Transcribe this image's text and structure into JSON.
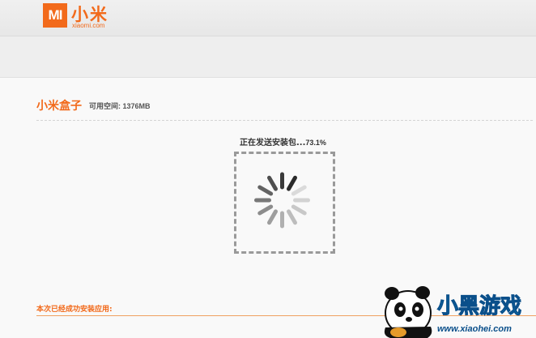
{
  "header": {
    "logo_mark": "MI",
    "logo_text": "小米",
    "logo_domain": "xiaomi.com",
    "brand_color": "#f26a1b"
  },
  "device": {
    "name": "小米盒子",
    "space_label": "可用空间:",
    "space_value": "1376MB"
  },
  "progress": {
    "status_text": "正在发送安装包...",
    "percent_text": "73.1%",
    "value": 0.731
  },
  "installed": {
    "label": "本次已经成功安装应用:"
  },
  "watermark": {
    "title": "小黑游戏",
    "url": "www.xiaohei.com"
  },
  "icons": {
    "spinner": "loading-spinner-icon",
    "mascot": "panda-mascot-icon"
  }
}
